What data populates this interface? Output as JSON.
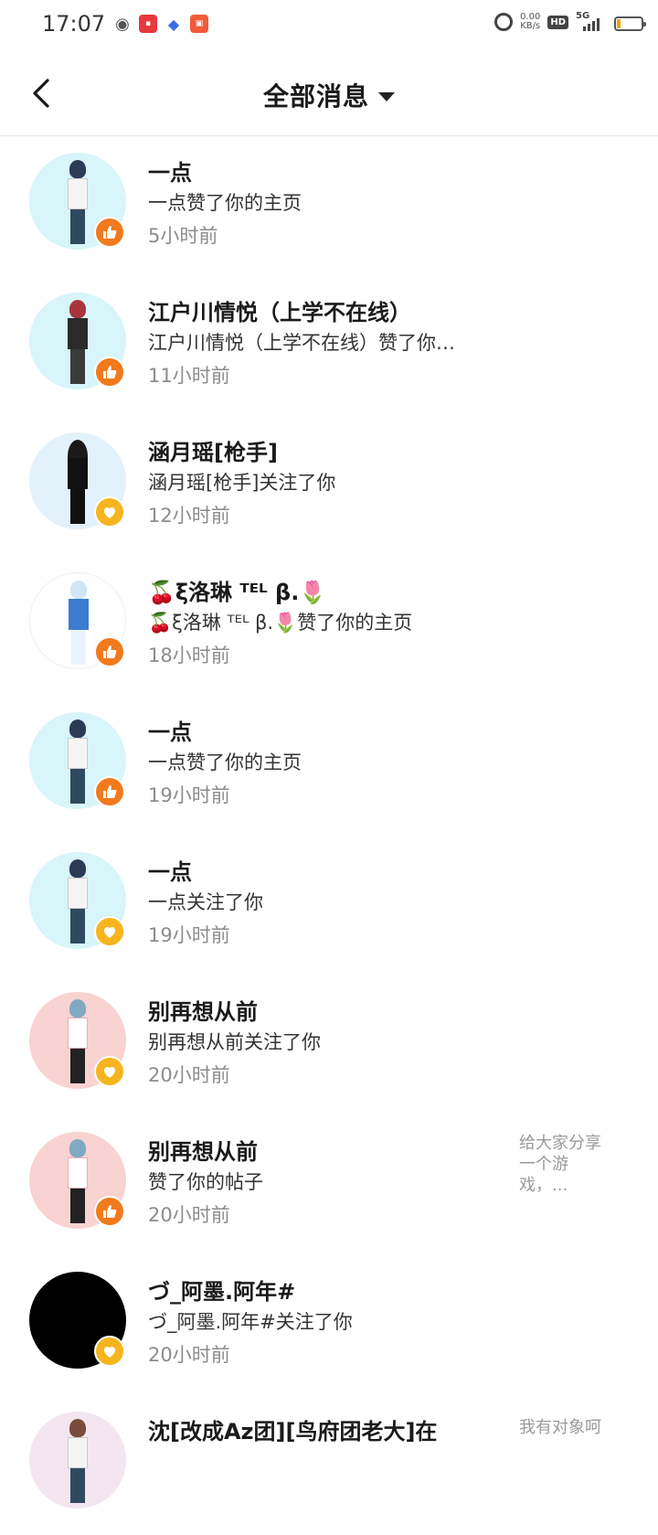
{
  "status_bar": {
    "time": "17:07",
    "speed_value": "0.00",
    "speed_unit": "KB/s",
    "hd": "HD",
    "network": "5G",
    "apps": [
      "wechat-icon",
      "xiaohongshu-icon",
      "baidu-icon",
      "kuaishou-icon"
    ]
  },
  "header": {
    "title": "全部消息"
  },
  "colors": {
    "like_badge": "#f07a1c",
    "follow_badge": "#f6b51e",
    "time_text": "#8c8c8c"
  },
  "messages": [
    {
      "name": "一点",
      "text": "一点赞了你的主页",
      "time": "5小时前",
      "type": "like"
    },
    {
      "name": "江户川情悦（上学不在线）",
      "text": "江户川情悦（上学不在线）赞了你…",
      "time": "11小时前",
      "type": "like"
    },
    {
      "name": "涵月瑶[枪手]",
      "text": "涵月瑶[枪手]关注了你",
      "time": "12小时前",
      "type": "follow"
    },
    {
      "name": "🍒ξ洛琳 ᵀᴱᴸ β.🌷",
      "text": "🍒ξ洛琳 ᵀᴱᴸ β.🌷赞了你的主页",
      "time": "18小时前",
      "type": "like"
    },
    {
      "name": "一点",
      "text": "一点赞了你的主页",
      "time": "19小时前",
      "type": "like"
    },
    {
      "name": "一点",
      "text": "一点关注了你",
      "time": "19小时前",
      "type": "follow"
    },
    {
      "name": "别再想从前",
      "text": "别再想从前关注了你",
      "time": "20小时前",
      "type": "follow"
    },
    {
      "name": "别再想从前",
      "text": "赞了你的帖子",
      "time": "20小时前",
      "type": "like",
      "preview": "给大家分享一个游戏，..."
    },
    {
      "name": "づ_阿墨.阿年#",
      "text": "づ_阿墨.阿年#关注了你",
      "time": "20小时前",
      "type": "follow"
    },
    {
      "name": "沈[改成Az团][鸟府团老大]在",
      "preview": "我有对象呵"
    }
  ]
}
